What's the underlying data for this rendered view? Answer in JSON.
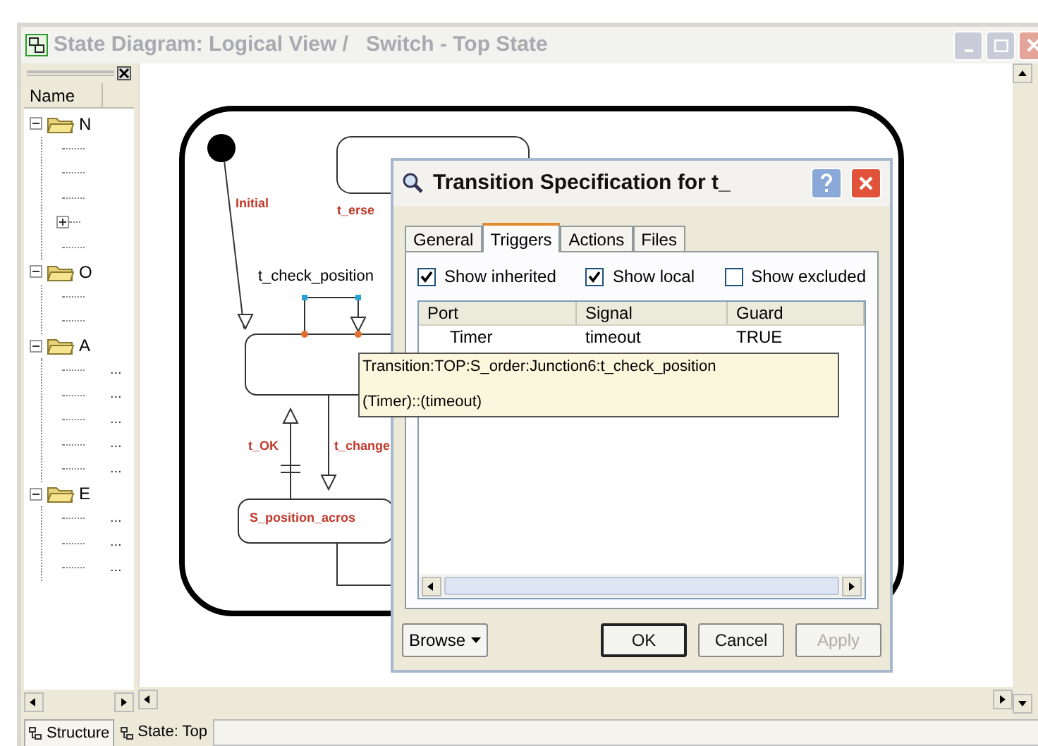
{
  "window": {
    "title": "State Diagram: Logical View /   Switch - Top State"
  },
  "tree": {
    "header": "Name",
    "items": [
      {
        "label": "N",
        "expanded": true,
        "children": [
          {
            "kind": "blank"
          },
          {
            "kind": "blank"
          },
          {
            "kind": "blank"
          },
          {
            "kind": "collapsed"
          },
          {
            "kind": "blank"
          }
        ]
      },
      {
        "label": "O",
        "expanded": true,
        "children": [
          {
            "kind": "blank"
          },
          {
            "kind": "blank"
          }
        ]
      },
      {
        "label": "A",
        "expanded": true,
        "children": [
          {
            "kind": "text",
            "label": "..."
          },
          {
            "kind": "text",
            "label": "..."
          },
          {
            "kind": "text",
            "label": "..."
          },
          {
            "kind": "text",
            "label": "..."
          },
          {
            "kind": "text",
            "label": "..."
          }
        ]
      },
      {
        "label": "E",
        "expanded": true,
        "children": [
          {
            "kind": "text",
            "label": "..."
          },
          {
            "kind": "text",
            "label": "..."
          },
          {
            "kind": "text",
            "label": "..."
          }
        ]
      }
    ]
  },
  "diagram": {
    "labels": [
      {
        "kind": "transition",
        "text": "Initial"
      },
      {
        "kind": "transition",
        "text": "t_erse"
      },
      {
        "kind": "selected_transition",
        "text": "t_check_position"
      },
      {
        "kind": "transition",
        "text": "t_OK"
      },
      {
        "kind": "transition",
        "text": "t_change"
      },
      {
        "kind": "state",
        "text": "S_position_acros"
      }
    ]
  },
  "dialog": {
    "title": "Transition Specification for t_",
    "tabs": [
      {
        "label": "General",
        "selected": false
      },
      {
        "label": "Triggers",
        "selected": true
      },
      {
        "label": "Actions",
        "selected": false
      },
      {
        "label": "Files",
        "selected": false
      }
    ],
    "checkboxes": [
      {
        "label": "Show inherited",
        "checked": true
      },
      {
        "label": "Show local",
        "checked": true
      },
      {
        "label": "Show excluded",
        "checked": false
      }
    ],
    "table": {
      "columns": [
        "Port",
        "Signal",
        "Guard"
      ],
      "rows": [
        [
          "Timer",
          "timeout",
          "TRUE"
        ]
      ]
    },
    "browse": "Browse",
    "buttons": [
      {
        "label": "OK",
        "default": true,
        "disabled": false
      },
      {
        "label": "Cancel",
        "default": false,
        "disabled": false
      },
      {
        "label": "Apply",
        "default": false,
        "disabled": true
      }
    ]
  },
  "tooltip": {
    "lines": [
      "Transition:TOP:S_order:Junction6:t_check_position",
      "(Timer)::(timeout)"
    ]
  },
  "bottom_tabs": [
    {
      "label": "Structure",
      "selected": true
    },
    {
      "label": "State: Top",
      "selected": false
    }
  ]
}
